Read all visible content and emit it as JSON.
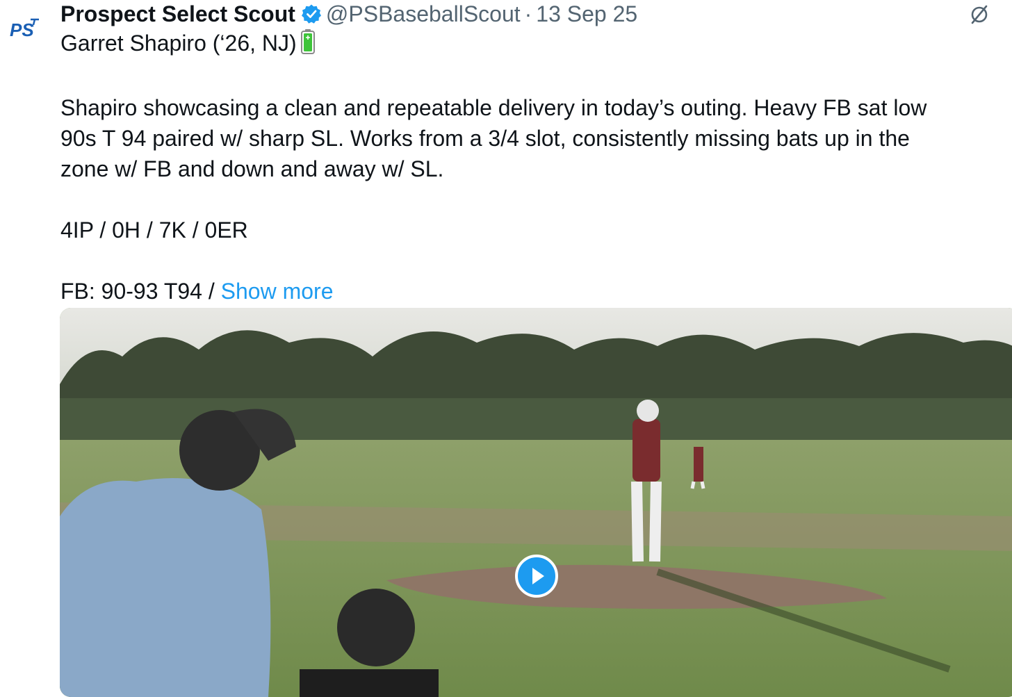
{
  "post": {
    "author_name": "Prospect Select Scout",
    "author_handle": "@PSBaseballScout",
    "separator": "·",
    "date": "13 Sep 25",
    "avatar_text": "PS",
    "title_line": "Garret Shapiro (‘26, NJ)",
    "paragraph_lines": [
      "Shapiro showcasing a clean and repeatable delivery in today’s outing. Heavy FB sat low",
      "90s T 94 paired w/ sharp SL. Works from a 3/4 slot, consistently missing bats up in the",
      "zone w/ FB and down and away w/ SL."
    ],
    "stat_line": "4IP / 0H / 7K / 0ER",
    "truncated_line": "FB: 90-93 T94 / ",
    "show_more_label": "Show more"
  },
  "icons": {
    "verified": "verified-badge-icon",
    "grok": "grok-icon",
    "battery": "battery-emoji-icon",
    "play": "play-icon"
  },
  "colors": {
    "link": "#1d9bf0",
    "secondary_text": "#536471",
    "primary_text": "#0f1419",
    "logo_blue": "#1a5fb4",
    "battery_green": "#3ec43a"
  }
}
